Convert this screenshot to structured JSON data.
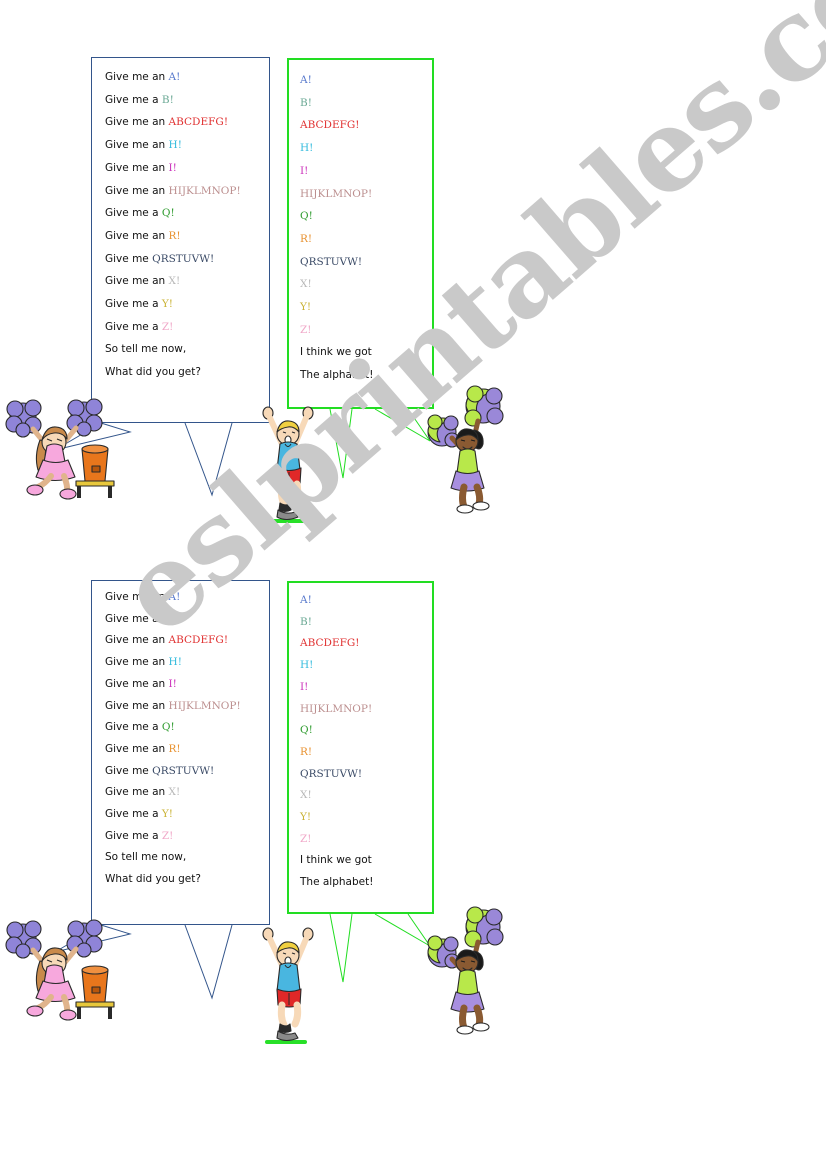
{
  "watermark": {
    "text": "eslprintables.com",
    "color": "#c9c9c9"
  },
  "colors": {
    "bubble_left_border": "#33558b",
    "bubble_right_border": "#22dd22",
    "ground_line": "#28e028",
    "text": "#111111"
  },
  "chant": {
    "prompts": [
      {
        "lead": "Give me an ",
        "letters": "A!",
        "color": "#5577cc"
      },
      {
        "lead": "Give me a  ",
        "letters": "B!",
        "color": "#6aa894"
      },
      {
        "lead": "Give me an ",
        "letters": "ABCDEFG!",
        "color": "#e03030"
      },
      {
        "lead": "Give me an ",
        "letters": "H!",
        "color": "#33bbdd"
      },
      {
        "lead": "Give me an ",
        "letters": "I!",
        "color": "#cc33bb"
      },
      {
        "lead": "Give me an ",
        "letters": "HIJKLMNOP!",
        "color": "#bc8f8f"
      },
      {
        "lead": "Give me a ",
        "letters": "Q!",
        "color": "#2e9b2e"
      },
      {
        "lead": "Give me an ",
        "letters": "R!",
        "color": "#e8912f"
      },
      {
        "lead": "Give me ",
        "letters": "QRSTUVW!",
        "color": "#3a4a66"
      },
      {
        "lead": "Give me an ",
        "letters": "X!",
        "color": "#b8b8b8"
      },
      {
        "lead": "Give me a ",
        "letters": "Y!",
        "color": "#c9b233"
      },
      {
        "lead": "Give me a ",
        "letters": "Z!",
        "color": "#f0a8c8"
      }
    ],
    "closing": [
      "So tell me now,",
      "What did you get?"
    ],
    "answers": [
      {
        "letters": "A!",
        "color": "#5577cc"
      },
      {
        "letters": "B!",
        "color": "#6aa894"
      },
      {
        "letters": "ABCDEFG!",
        "color": "#e03030"
      },
      {
        "letters": "H!",
        "color": "#33bbdd"
      },
      {
        "letters": "I!",
        "color": "#cc33bb"
      },
      {
        "letters": "HIJKLMNOP!",
        "color": "#bc8f8f"
      },
      {
        "letters": "Q!",
        "color": "#2e9b2e"
      },
      {
        "letters": "R!",
        "color": "#e8912f"
      },
      {
        "letters": "QRSTUVW!",
        "color": "#3a4a66"
      },
      {
        "letters": "X!",
        "color": "#b8b8b8"
      },
      {
        "letters": "Y!",
        "color": "#c9b233"
      },
      {
        "letters": "Z!",
        "color": "#f0a8c8"
      }
    ],
    "answer_closing": [
      "I think we got",
      "The alphabet!"
    ]
  },
  "figures": {
    "cheer_left": {
      "name": "cheerleader-pink",
      "pompom_color": "#8f84d8",
      "outfit_color": "#f7a8dd",
      "cooler_color": "#e8761c",
      "stool_color": "#e8c83c"
    },
    "jumper": {
      "name": "jumping-boy",
      "shirt_color": "#49b6e0",
      "shorts_color": "#e02828",
      "hair_color": "#f0d040"
    },
    "cheer_right": {
      "name": "cheerleader-green",
      "pompom_colors": [
        "#b8e84a",
        "#9a88d8"
      ],
      "top_color": "#b8e84a",
      "skirt_color": "#a88fe0"
    }
  }
}
